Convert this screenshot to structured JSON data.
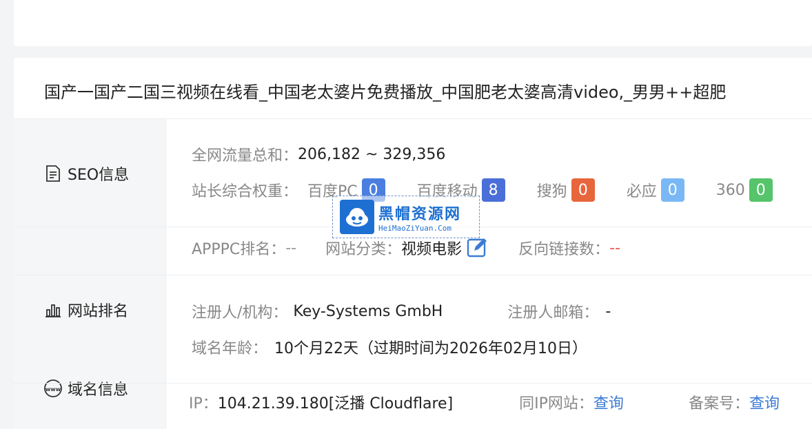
{
  "site_title": "国产一国产二国三视频在线看_中国老太婆片免费播放_中国肥老太婆高清video,_男男++超肥",
  "sidebar": {
    "seo": "SEO信息",
    "rank": "网站排名",
    "domain": "域名信息"
  },
  "seo": {
    "traffic_label": "全网流量总和：",
    "traffic_value": "206,182 ~ 329,356",
    "weight_label": "站长综合权重：",
    "engines": [
      {
        "name": "百度PC",
        "value": "0",
        "color": "#4a7fe0"
      },
      {
        "name": "百度移动",
        "value": "8",
        "color": "#4a6fd8"
      },
      {
        "name": "搜狗",
        "value": "0",
        "color": "#e8663c"
      },
      {
        "name": "必应",
        "value": "0",
        "color": "#7ab8f5"
      },
      {
        "name": "360",
        "value": "0",
        "color": "#55c46a"
      }
    ]
  },
  "rank": {
    "apppc_label": "APPPC排名：",
    "apppc_value": "--",
    "category_label": "网站分类：",
    "category_value": "视频电影",
    "backlinks_label": "反向链接数：",
    "backlinks_value": "--"
  },
  "domain": {
    "registrant_label": "注册人/机构：",
    "registrant_value": "Key-Systems GmbH",
    "email_label": "注册人邮箱：",
    "email_value": "-",
    "age_label": "域名年龄：",
    "age_value": "10个月22天（过期时间为2026年02月10日）"
  },
  "ip": {
    "ip_label": "IP：",
    "ip_value": "104.21.39.180[泛播 Cloudflare]",
    "same_ip_label": "同IP网站：",
    "same_ip_link": "查询",
    "icp_label": "备案号：",
    "icp_link": "查询"
  },
  "watermark": {
    "cn": "黑帽资源网",
    "en": "HeiMaoZiYuan.Com"
  },
  "icons": [
    "document-icon",
    "bar-chart-icon",
    "www-icon",
    "edit-icon",
    "watermark-logo-icon"
  ]
}
